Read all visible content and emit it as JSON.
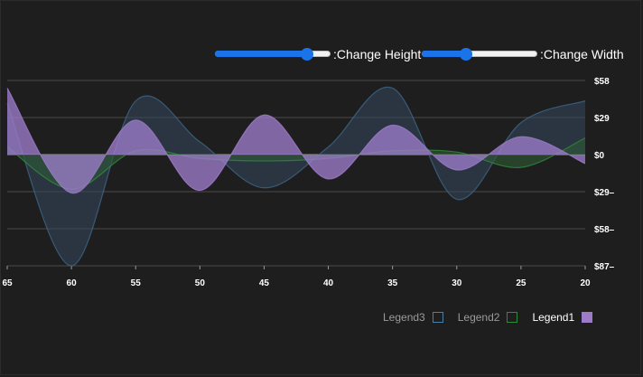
{
  "controls": {
    "height_label": ":Change Height",
    "width_label": ":Change Width",
    "height_value": 0.8,
    "width_value": 0.38,
    "accent_color": "#1a73e8"
  },
  "legend": [
    {
      "label": "Legend3",
      "color": "#4a7fa6",
      "filled": false,
      "active": false
    },
    {
      "label": "Legend2",
      "color": "#2e8b3a",
      "filled": false,
      "active": false
    },
    {
      "label": "Legend1",
      "color": "#9c7cc9",
      "filled": true,
      "active": true
    }
  ],
  "chart_data": {
    "type": "area",
    "x": [
      65,
      60,
      55,
      50,
      45,
      40,
      35,
      30,
      25,
      20
    ],
    "x_tick_labels": [
      "65",
      "60",
      "55",
      "50",
      "45",
      "40",
      "35",
      "30",
      "25",
      "20"
    ],
    "x_reversed": true,
    "y_tick_labels": [
      "$58",
      "$29",
      "$0",
      "$29–",
      "$58–",
      "$87–"
    ],
    "ylim": [
      -87,
      58
    ],
    "grid": true,
    "series": [
      {
        "name": "Legend3",
        "color": "#4a7fa6",
        "values": [
          40,
          -87,
          42,
          10,
          -26,
          6,
          52,
          -35,
          25,
          42
        ]
      },
      {
        "name": "Legend2",
        "color": "#2e8b3a",
        "values": [
          6,
          -27,
          3,
          -3,
          -5,
          -3,
          3,
          2,
          -10,
          13
        ]
      },
      {
        "name": "Legend1",
        "color": "#9c7cc9",
        "values": [
          52,
          -30,
          27,
          -28,
          31,
          -19,
          23,
          -12,
          14,
          -7
        ]
      }
    ]
  }
}
